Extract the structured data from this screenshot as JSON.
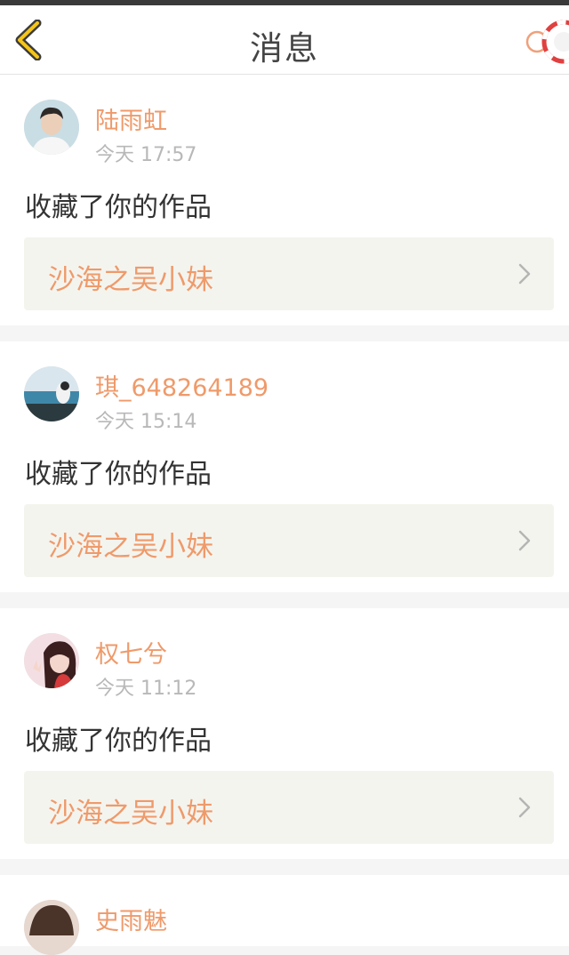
{
  "header": {
    "title": "消息",
    "back_icon": "chevron-left-icon",
    "help_icon": "lifebuoy-icon",
    "accent": "#f5c518"
  },
  "colors": {
    "accent_orange": "#ef9a6a",
    "work_bg": "#f4f4ef"
  },
  "messages": [
    {
      "user": "陆雨虹",
      "time": "今天 17:57",
      "action": "收藏了你的作品",
      "work": "沙海之吴小妹"
    },
    {
      "user": "琪_648264189",
      "time": "今天 15:14",
      "action": "收藏了你的作品",
      "work": "沙海之吴小妹"
    },
    {
      "user": "权七兮",
      "time": "今天 11:12",
      "action": "收藏了你的作品",
      "work": "沙海之吴小妹"
    },
    {
      "user": "史雨魅"
    }
  ]
}
